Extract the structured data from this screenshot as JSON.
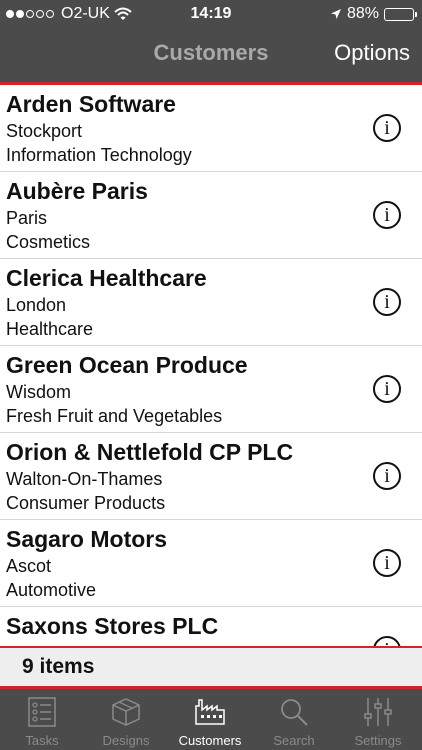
{
  "status_bar": {
    "carrier": "O2-UK",
    "time": "14:19",
    "battery": "88%",
    "battery_level": 0.88
  },
  "nav": {
    "title": "Customers",
    "options_label": "Options"
  },
  "customers": [
    {
      "name": "Arden Software",
      "city": "Stockport",
      "industry": "Information Technology"
    },
    {
      "name": "Aubère Paris",
      "city": "Paris",
      "industry": "Cosmetics"
    },
    {
      "name": "Clerica Healthcare",
      "city": "London",
      "industry": "Healthcare"
    },
    {
      "name": "Green Ocean Produce",
      "city": "Wisdom",
      "industry": "Fresh Fruit and Vegetables"
    },
    {
      "name": "Orion & Nettlefold CP PLC",
      "city": "Walton-On-Thames",
      "industry": "Consumer Products"
    },
    {
      "name": "Sagaro Motors",
      "city": "Ascot",
      "industry": "Automotive"
    },
    {
      "name": "Saxons Stores PLC",
      "city": "",
      "industry": ""
    }
  ],
  "info_glyph": "i",
  "footer": {
    "count_label": "9 items"
  },
  "tabs": [
    {
      "label": "Tasks",
      "icon": "tasks-icon"
    },
    {
      "label": "Designs",
      "icon": "designs-icon"
    },
    {
      "label": "Customers",
      "icon": "customers-icon",
      "active": true
    },
    {
      "label": "Search",
      "icon": "search-icon"
    },
    {
      "label": "Settings",
      "icon": "settings-icon"
    }
  ],
  "colors": {
    "bar_background": "#4b4b4b",
    "accent_red": "#d3242b",
    "active_tab": "#ffffff",
    "inactive_tab": "#8a8a8a"
  }
}
